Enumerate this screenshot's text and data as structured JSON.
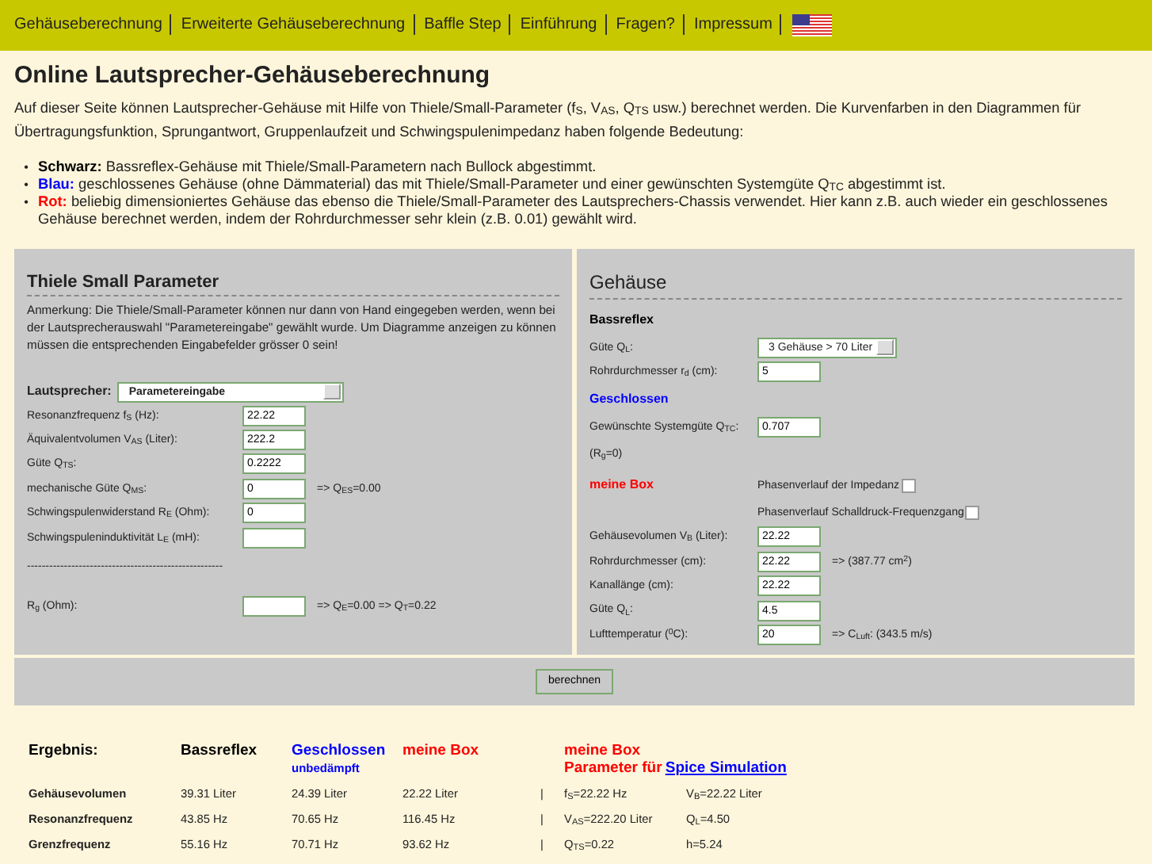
{
  "nav": [
    {
      "label": "Gehäuseberechnung"
    },
    {
      "label": "Erweiterte Gehäuseberechnung"
    },
    {
      "label": "Baffle Step"
    },
    {
      "label": "Einführung"
    },
    {
      "label": "Fragen?"
    },
    {
      "label": "Impressum"
    }
  ],
  "title": "Online Lautsprecher-Gehäuseberechnung",
  "intro": "Auf dieser Seite können Lautsprecher-Gehäuse mit Hilfe von Thiele/Small-Parameter (f$_{S}$, V$_{AS}$, Q$_{TS}$ usw.) berechnet werden. Die Kurvenfarben in den Diagrammen für Übertragungsfunktion, Sprungantwort, Gruppenlaufzeit und Schwingspulenimpedanz haben folgende Bedeutung:",
  "legend": [
    {
      "bullet": "•",
      "label": "Schwarz:",
      "color": "#000000",
      "text": "Bassreflex-Gehäuse mit Thiele/Small-Parametern nach Bullock abgestimmt."
    },
    {
      "bullet": "•",
      "label": "Blau:",
      "color": "#0000ff",
      "text": "geschlossenes Gehäuse (ohne Dämmaterial) das mit Thiele/Small-Parameter und einer gewünschten Systemgüte Q$_{TC}$ abgestimmt ist."
    },
    {
      "bullet": "•",
      "label": "Rot:",
      "color": "#ff0000",
      "text": "beliebig dimensioniertes Gehäuse das ebenso die Thiele/Small-Parameter des Lautsprechers-Chassis verwendet. Hier kann z.B. auch wieder ein geschlossenes Gehäuse berechnet werden, indem der Rohrdurchmesser sehr klein (z.B. 0.01) gewählt wird."
    }
  ],
  "left_panel": {
    "title": "Thiele Small Parameter",
    "note": "Anmerkung: Die Thiele/Small-Parameter können nur dann von Hand eingegeben werden, wenn bei der Lautsprecherauswahl \"Parametereingabe\" gewählt wurde. Um Diagramme anzeigen zu können müssen die entsprechenden Eingabefelder grösser 0 sein!",
    "speaker": {
      "label": "Lautsprecher:",
      "value": "Parametereingabe"
    },
    "rows": [
      {
        "kind": "input",
        "label": "Resonanzfrequenz f$_{S}$ (Hz):",
        "value": "22.22"
      },
      {
        "kind": "input",
        "label": "Äquivalentvolumen V$_{AS}$ (Liter):",
        "value": "222.2"
      },
      {
        "kind": "input",
        "label": "Güte Q$_{TS}$:",
        "value": "0.2222"
      },
      {
        "kind": "input",
        "label": "mechanische Güte Q$_{MS}$:",
        "value": "0",
        "result": "=> Q$_{ES}$=0.00"
      },
      {
        "kind": "input",
        "label": "Schwingspulenwiderstand R$_{E}$ (Ohm):",
        "value": "0"
      },
      {
        "kind": "input",
        "label": "Schwingspuleninduktivität L$_{E}$ (mH):",
        "value": ""
      },
      {
        "kind": "separator",
        "label": "-----------------------------------------------------"
      },
      {
        "kind": "input",
        "label": "R$_{g}$ (Ohm):",
        "value": "",
        "result": "=> Q$_{E}$=0.00 => Q$_{T}$=0.22"
      }
    ]
  },
  "right_panel": {
    "title": "Gehäuse",
    "rows": [
      {
        "kind": "heading",
        "label": "Bassreflex",
        "color": "#000000"
      },
      {
        "kind": "select",
        "label": "Güte Q$_{L}$:",
        "value": "3 Gehäuse > 70 Liter"
      },
      {
        "kind": "input",
        "label": "Rohrdurchmesser r$_{d}$ (cm):",
        "value": "5"
      },
      {
        "kind": "heading",
        "label": "Geschlossen",
        "color": "#0000ff"
      },
      {
        "kind": "input",
        "label": "Gewünschte Systemgüte Q$_{TC}$:",
        "value": "0.707"
      },
      {
        "kind": "note",
        "label": "(R$_{g}$=0)"
      },
      {
        "kind": "heading",
        "label": "meine Box",
        "color": "#ff0000",
        "checkbox": {
          "label": "Phasenverlauf der Impedanz",
          "checked": false
        }
      },
      {
        "kind": "checkbox",
        "label": "Phasenverlauf Schalldruck-Frequenzgang",
        "checked": false
      },
      {
        "kind": "input",
        "label": "Gehäusevolumen V$_{B}$ (Liter):",
        "value": "22.22"
      },
      {
        "kind": "input",
        "label": "Rohrdurchmesser (cm):",
        "value": "22.22",
        "result": "=> (387.77 cm$^{2}$)"
      },
      {
        "kind": "input",
        "label": "Kanallänge (cm):",
        "value": "22.22"
      },
      {
        "kind": "input",
        "label": "Güte Q$_{L}$:",
        "value": "4.5"
      },
      {
        "kind": "input",
        "label": "Lufttemperatur ($^{0}$C):",
        "value": "20",
        "result": "=> C$_{Luft}$: (343.5 m/s)"
      }
    ]
  },
  "submit": "berechnen",
  "results": {
    "headers": [
      {
        "label": "Ergebnis:",
        "color": "#000000"
      },
      {
        "label": "Bassreflex",
        "color": "#000000"
      },
      {
        "label": "Geschlossen",
        "color": "#0000ff",
        "sub": "unbedämpft"
      },
      {
        "label": "meine Box",
        "color": "#ff0000"
      },
      {
        "label": "meine Box",
        "color": "#ff0000",
        "sub": "Parameter für",
        "link": "Spice Simulation"
      }
    ],
    "rows": [
      {
        "label": "Gehäusevolumen",
        "values": [
          "39.31 Liter",
          "24.39 Liter",
          "22.22 Liter"
        ],
        "sep": "|",
        "spice": [
          "f$_{S}$=22.22 Hz",
          "V$_{B}$=22.22 Liter"
        ]
      },
      {
        "label": "Resonanzfrequenz",
        "values": [
          "43.85 Hz",
          "70.65 Hz",
          "116.45 Hz"
        ],
        "sep": "|",
        "spice": [
          "V$_{AS}$=222.20 Liter",
          "Q$_{L}$=4.50"
        ]
      },
      {
        "label": "Grenzfrequenz",
        "values": [
          "55.16 Hz",
          "70.71 Hz",
          "93.62 Hz"
        ],
        "sep": "|",
        "spice": [
          "Q$_{TS}$=0.22",
          "h=5.24"
        ]
      }
    ]
  }
}
